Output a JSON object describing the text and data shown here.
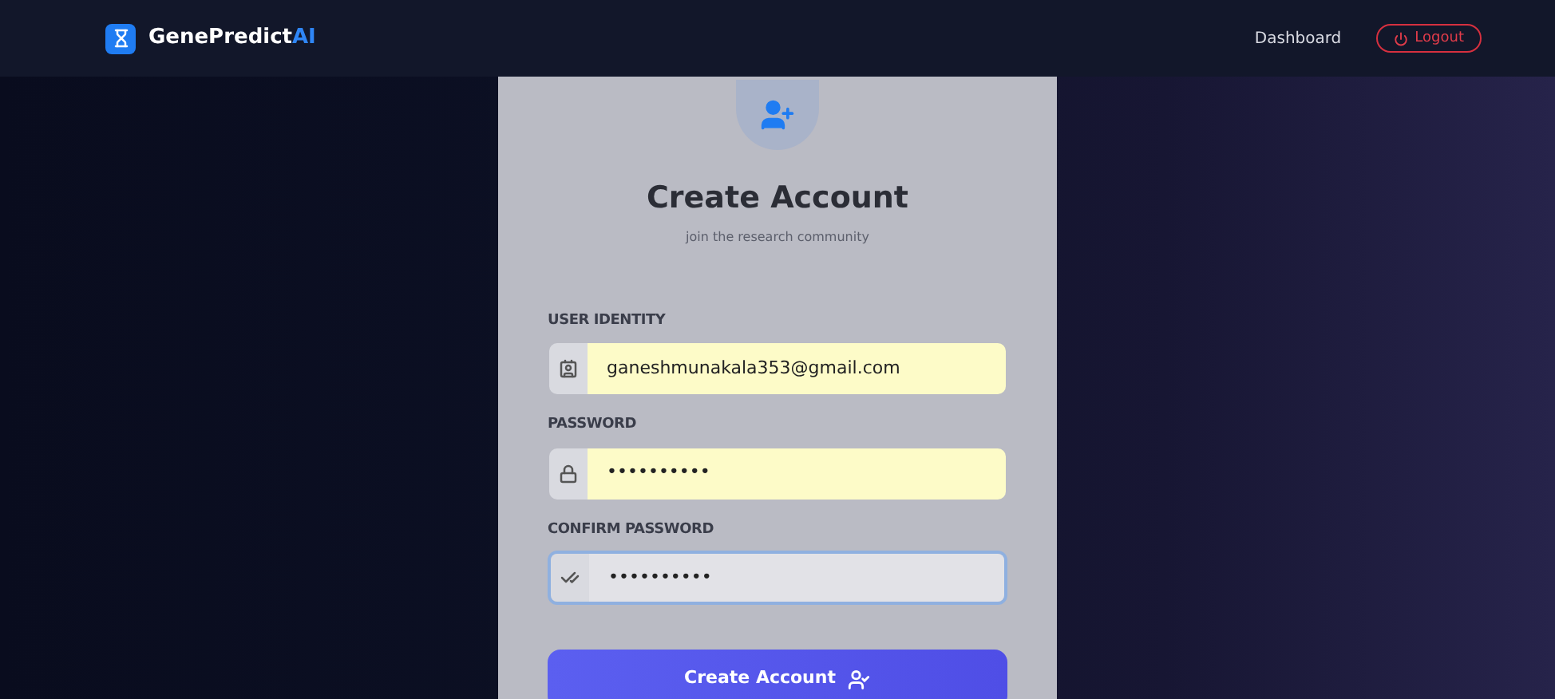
{
  "navbar": {
    "brand_name": "GenePredict",
    "brand_suffix": "AI",
    "links": [
      {
        "label": "Dashboard",
        "kind": "link"
      },
      {
        "label": "Logout",
        "kind": "danger"
      }
    ]
  },
  "card": {
    "title": "Create Account",
    "subtitle": "join the research community",
    "fields": [
      {
        "label": "USER IDENTITY",
        "kind": "email",
        "value": "ganeshmunakala353@gmail.com",
        "autofilled": true,
        "focused": false
      },
      {
        "label": "PASSWORD",
        "kind": "password",
        "value": "••••••••••",
        "autofilled": true,
        "focused": false
      },
      {
        "label": "CONFIRM PASSWORD",
        "kind": "confirm",
        "value": "••••••••••",
        "autofilled": false,
        "focused": true
      }
    ],
    "submit": "Create Account"
  }
}
